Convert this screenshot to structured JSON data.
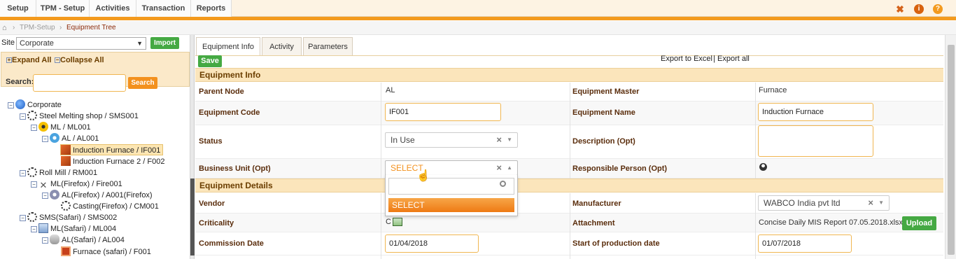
{
  "menu": {
    "items": [
      "Setup",
      "TPM - Setup",
      "Activities",
      "Transaction",
      "Reports"
    ],
    "icons": [
      "pin-icon",
      "info-icon",
      "help-icon"
    ]
  },
  "breadcrumb": {
    "home_icon": "home-icon",
    "level1": "TPM-Setup",
    "current": "Equipment Tree"
  },
  "left": {
    "site_label": "Site",
    "site_value": "Corporate",
    "import_label": "Import",
    "expand_all": "Expand All",
    "collapse_all": "Collapse All",
    "search_label": "Search:",
    "search_value": "",
    "search_button": "Search",
    "tree": [
      "Corporate",
      "Steel Melting shop / SMS001",
      "ML / ML001",
      "AL / AL001",
      "Induction Furnace / IF001",
      "Induction Furnace 2 / F002",
      "Roll Mill / RM001",
      "ML(Firefox) / Fire001",
      "AL(Firefox) / A001(Firefox)",
      "Casting(Firefox) / CM001",
      "SMS(Safari) / SMS002",
      "ML(Safari) / ML004",
      "AL(Safari) / AL004",
      "Furnace (safari) / F001"
    ]
  },
  "tabs": [
    "Equipment Info",
    "Activity",
    "Parameters"
  ],
  "toolbar": {
    "save": "Save",
    "export_excel": "Export to Excel",
    "separator": "|",
    "export_all": "Export all"
  },
  "equipment_info": {
    "section": "Equipment Info",
    "parent_node_label": "Parent Node",
    "parent_node": "AL",
    "equipment_master_label": "Equipment Master",
    "equipment_master": "Furnace",
    "equipment_code_label": "Equipment Code",
    "equipment_code": "IF001",
    "equipment_name_label": "Equipment Name",
    "equipment_name": "Induction Furnace",
    "status_label": "Status",
    "status": "In Use",
    "description_label": "Description (Opt)",
    "description": "",
    "business_unit_label": "Business Unit (Opt)",
    "business_unit": "SELECT",
    "responsible_person_label": "Responsible Person (Opt)"
  },
  "dropdown": {
    "search_value": "",
    "option": "SELECT"
  },
  "equipment_details": {
    "section": "Equipment Details",
    "vendor_label": "Vendor",
    "manufacturer_label": "Manufacturer",
    "manufacturer": "WABCO India pvt ltd",
    "criticality_label": "Criticality",
    "criticality": "C",
    "attachment_label": "Attachment",
    "attachment": "Concise Daily MIS Report 07.05.2018.xlsx",
    "upload": "Upload",
    "commission_date_label": "Commission Date",
    "commission_date": "01/04/2018",
    "start_production_label": "Start of production date",
    "start_production": "01/07/2018"
  },
  "colors": {
    "accent": "#f39a1e",
    "green": "#45a943",
    "label": "#5a2d0c",
    "section_bg": "#fbe5bb"
  }
}
